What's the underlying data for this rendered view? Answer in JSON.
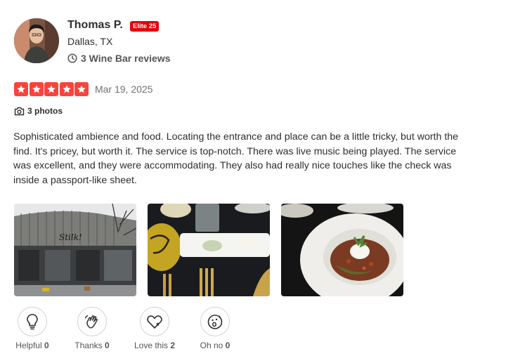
{
  "user": {
    "name": "Thomas P.",
    "elite_badge": "Elite 25",
    "location": "Dallas, TX",
    "review_count": "3 Wine Bar reviews"
  },
  "review": {
    "rating": 5,
    "date": "Mar 19, 2025",
    "photos_label": "3 photos",
    "text": "Sophisticated ambience and food. Locating the entrance and place can be a little tricky, but worth the find. It's pricey, but worth it. The service is top-notch. There was live music being played. The service was excellent, and they were accommodating. They also had really nice touches like the check was inside a passport-like sheet."
  },
  "photos": [
    {
      "icon": "storefront-photo"
    },
    {
      "icon": "appetizer-photo"
    },
    {
      "icon": "pasta-dish-photo"
    }
  ],
  "reactions": [
    {
      "label": "Helpful",
      "count": "0",
      "icon": "lightbulb-icon"
    },
    {
      "label": "Thanks",
      "count": "0",
      "icon": "wave-hand-icon"
    },
    {
      "label": "Love this",
      "count": "2",
      "icon": "heart-icon"
    },
    {
      "label": "Oh no",
      "count": "0",
      "icon": "surprised-face-icon"
    }
  ],
  "colors": {
    "star": "#fb433c",
    "elite_badge": "#e00707",
    "text": "#2d2e2f",
    "muted": "#6e7072"
  }
}
